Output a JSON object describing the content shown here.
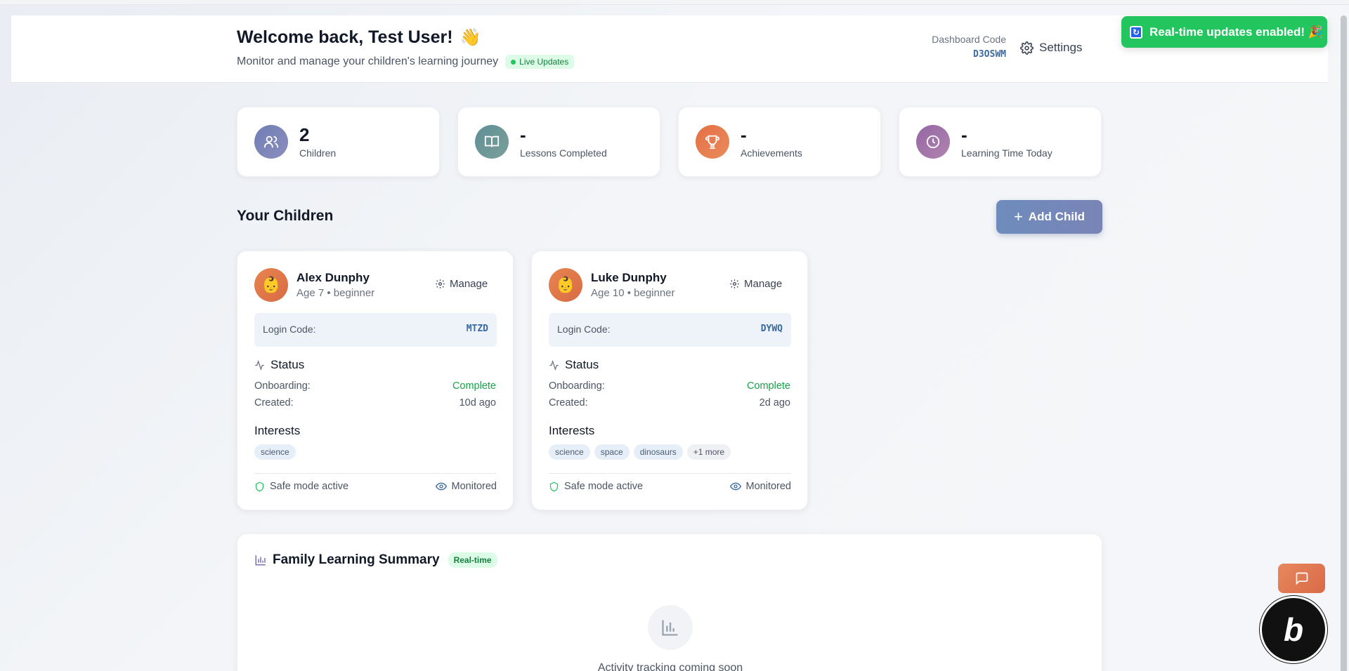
{
  "header": {
    "welcome": "Welcome back, Test User!",
    "wave_emoji": "👋",
    "subtitle": "Monitor and manage your children's learning journey",
    "live_badge": "Live Updates",
    "dashboard_code_label": "Dashboard Code",
    "dashboard_code": "D3OSWM",
    "settings_label": "Settings"
  },
  "toast": {
    "text": "Real-time updates enabled! 🎉",
    "icon": "refresh-icon"
  },
  "stats": [
    {
      "value": "2",
      "label": "Children",
      "icon": "users-icon",
      "color": "#7d86b8"
    },
    {
      "value": "-",
      "label": "Lessons Completed",
      "icon": "book-icon",
      "color": "#6b9a99"
    },
    {
      "value": "-",
      "label": "Achievements",
      "icon": "trophy-icon",
      "color": "#e2774e"
    },
    {
      "value": "-",
      "label": "Learning Time Today",
      "icon": "clock-icon",
      "color": "#9d73a6"
    }
  ],
  "children_section": {
    "title": "Your Children",
    "add_label": "Add Child"
  },
  "children": [
    {
      "name": "Alex Dunphy",
      "meta": "Age 7 • beginner",
      "avatar": "👶",
      "manage_label": "Manage",
      "login_label": "Login Code:",
      "login_code": "MTZD",
      "status_title": "Status",
      "onboarding_label": "Onboarding:",
      "onboarding_value": "Complete",
      "created_label": "Created:",
      "created_value": "10d ago",
      "interests_title": "Interests",
      "interests": [
        "science"
      ],
      "more": "",
      "safe_mode": "Safe mode active",
      "monitored": "Monitored"
    },
    {
      "name": "Luke Dunphy",
      "meta": "Age 10 • beginner",
      "avatar": "👶",
      "manage_label": "Manage",
      "login_label": "Login Code:",
      "login_code": "DYWQ",
      "status_title": "Status",
      "onboarding_label": "Onboarding:",
      "onboarding_value": "Complete",
      "created_label": "Created:",
      "created_value": "2d ago",
      "interests_title": "Interests",
      "interests": [
        "science",
        "space",
        "dinosaurs"
      ],
      "more": "+1 more",
      "safe_mode": "Safe mode active",
      "monitored": "Monitored"
    }
  ],
  "summary": {
    "title": "Family Learning Summary",
    "badge": "Real-time",
    "empty_text": "Activity tracking coming soon"
  },
  "colors": {
    "accent": "#22c55e",
    "primary": "#6d8cbc",
    "code": "#3b6aa0"
  }
}
